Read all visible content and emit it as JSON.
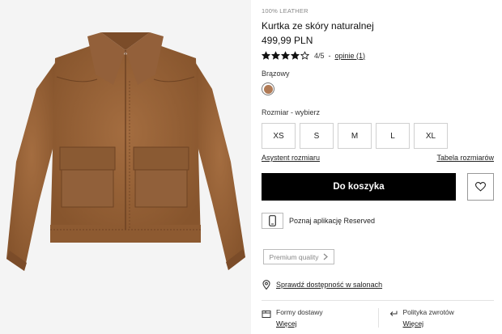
{
  "product": {
    "material_badge": "100% LEATHER",
    "title": "Kurtka ze skóry naturalnej",
    "price": "499,99 PLN",
    "rating": {
      "value": 4,
      "max": 5,
      "score_text": "4/5",
      "separator": "-",
      "reviews_link": "opinie (1)"
    },
    "color": {
      "label": "Brązowy",
      "swatch": "#b07a55"
    },
    "size": {
      "label": "Rozmiar -  wybierz",
      "options": [
        "XS",
        "S",
        "M",
        "L",
        "XL"
      ]
    },
    "size_assistant_link": "Asystent rozmiaru",
    "size_table_link": "Tabela rozmiarów",
    "add_to_cart": "Do koszyka",
    "app_promo": "Poznaj aplikację Reserved",
    "premium_label": "Premium quality",
    "store_availability": "Sprawdź dostępność w salonach",
    "delivery": {
      "label": "Formy dostawy",
      "more": "Więcej"
    },
    "returns": {
      "label": "Polityka zwrotów",
      "more": "Więcej"
    }
  },
  "icons": {
    "star": "star-icon",
    "heart": "heart-icon",
    "phone": "phone-icon",
    "chevron": "chevron-right-icon",
    "pin": "location-pin-icon",
    "delivery": "package-icon",
    "returns": "return-arrow-icon"
  },
  "colors": {
    "jacket": "#9a6438",
    "jacket_dark": "#6e4323",
    "background": "#f4f4f4",
    "button": "#000000"
  }
}
